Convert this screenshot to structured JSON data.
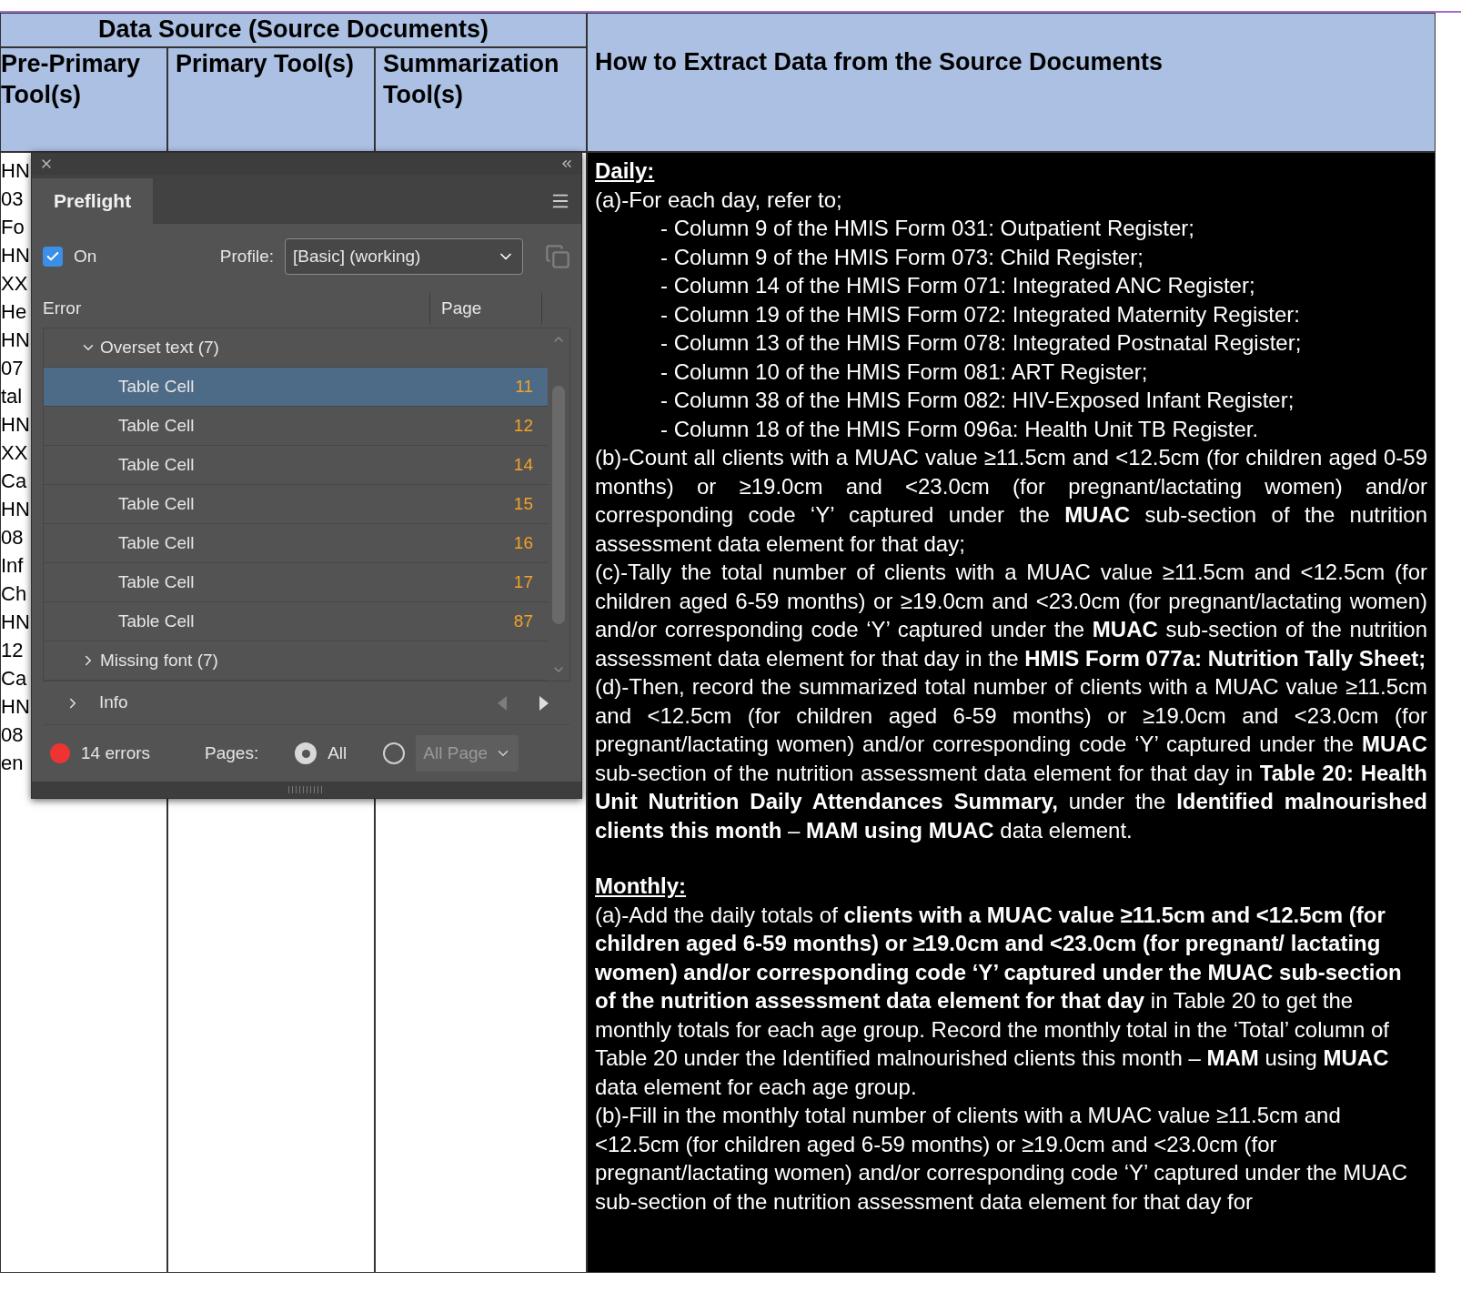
{
  "table": {
    "group_header": "Data Source (Source Documents)",
    "columns": [
      "Pre-Primary Tool(s)",
      "Primary Tool(s)",
      "Summarization Tool(s)",
      "How to Extract Data from the Source Documents"
    ],
    "column_1_fragments": [
      "HN",
      "03",
      "Fo",
      "HN",
      "XX",
      "He",
      "HN",
      "07",
      "tal",
      "HN",
      "XX",
      "Ca",
      "HN",
      "08",
      "Inf",
      "Ch",
      "HN",
      "12",
      "Ca",
      "HN",
      "08",
      "en"
    ],
    "sections": [
      {
        "heading": "Daily:",
        "paragraphs": [
          {
            "kind": "plain",
            "text": "(a)-For each day, refer to;"
          },
          {
            "kind": "list-item",
            "text": "- Column 9 of the HMIS Form 031: Outpatient Register;"
          },
          {
            "kind": "list-item",
            "text": "- Column 9 of the HMIS Form 073: Child Register;"
          },
          {
            "kind": "list-item",
            "text": "- Column 14 of the HMIS Form 071: Integrated ANC Register;"
          },
          {
            "kind": "list-item",
            "text": "- Column 19 of the HMIS Form 072: Integrated Maternity Register:"
          },
          {
            "kind": "list-item",
            "text": "- Column 13 of the HMIS Form 078: Integrated Postnatal Register;"
          },
          {
            "kind": "list-item",
            "text": "- Column 10 of the HMIS Form 081: ART Register;"
          },
          {
            "kind": "list-item",
            "text": "- Column 38 of the HMIS Form 082: HIV-Exposed Infant Register;"
          },
          {
            "kind": "list-item",
            "text": "- Column 18 of the HMIS Form 096a: Health Unit TB Register."
          },
          {
            "kind": "justified",
            "text": "(b)-Count all clients with a MUAC value ≥11.5cm and <12.5cm (for children aged 0-59 months) or ≥19.0cm and <23.0cm (for pregnant/lactating women) and/or corresponding code ‘Y’ captured under the **MUAC** sub-section of the nutrition assessment data element for that day;"
          },
          {
            "kind": "justified",
            "text": "(c)-Tally the total number of clients with a MUAC value ≥11.5cm and <12.5cm (for children aged 6-59 months) or ≥19.0cm and <23.0cm (for pregnant/lactating women) and/or corresponding code ‘Y’ captured under the **MUAC** sub-section of the nutrition assessment data element for that day in the **HMIS Form 077a: Nutrition Tally Sheet;**"
          },
          {
            "kind": "justified",
            "text": "(d)-Then, record the summarized total number of clients with a MUAC value ≥11.5cm and <12.5cm (for children aged 6-59 months) or ≥19.0cm and <23.0cm (for pregnant/lactating women) and/or corresponding code ‘Y’ captured under the **MUAC** sub-section of the nutrition assessment data element for that day in **Table 20: Health Unit Nutrition Daily Attendances Summary,** under the **Identified malnourished clients this month** – **MAM using MUAC** data element."
          }
        ]
      },
      {
        "heading": "Monthly:",
        "paragraphs": [
          {
            "kind": "plain",
            "text": "(a)-Add the daily totals of **clients with a MUAC value ≥11.5cm and <12.5cm (for children aged 6-59 months) or ≥19.0cm and <23.0cm (for pregnant/ lactating women) and/or corresponding code ‘Y’ captured under the MUAC sub-section of the nutrition assessment data element for that day** in Table 20 to get the monthly totals for each age group. Record the monthly total in the ‘Total’ column of Table 20 under the Identified malnourished clients this month – **MAM** using **MUAC** data element for each age group."
          },
          {
            "kind": "plain",
            "text": "(b)-Fill in the monthly total number of clients with a MUAC value ≥11.5cm and <12.5cm (for children aged 6-59 months) or ≥19.0cm and <23.0cm (for pregnant/lactating women) and/or corresponding code ‘Y’ captured under the MUAC sub-section of the nutrition assessment data element for that day for"
          }
        ]
      }
    ]
  },
  "preflight_panel": {
    "tab": "Preflight",
    "on": {
      "label": "On",
      "checked": true
    },
    "profile_label": "Profile:",
    "profile_value": "[Basic] (working)",
    "columns": [
      "Error",
      "Page"
    ],
    "groups": [
      {
        "label": "Overset text (7)",
        "expanded": true,
        "items": [
          {
            "label": "Table Cell",
            "page": "11",
            "selected": true
          },
          {
            "label": "Table Cell",
            "page": "12",
            "selected": false
          },
          {
            "label": "Table Cell",
            "page": "14",
            "selected": false
          },
          {
            "label": "Table Cell",
            "page": "15",
            "selected": false
          },
          {
            "label": "Table Cell",
            "page": "16",
            "selected": false
          },
          {
            "label": "Table Cell",
            "page": "17",
            "selected": false
          },
          {
            "label": "Table Cell",
            "page": "87",
            "selected": false
          }
        ]
      },
      {
        "label": "Missing font (7)",
        "expanded": false
      }
    ],
    "info": {
      "label": "Info",
      "expanded": false
    },
    "errors": "14 errors",
    "pages_label": "Pages:",
    "pages_options": [
      {
        "kind": "plain",
        "label": "All",
        "selected": true
      },
      {
        "kind": "dropdown",
        "label": "All Page",
        "selected": false
      }
    ]
  }
}
